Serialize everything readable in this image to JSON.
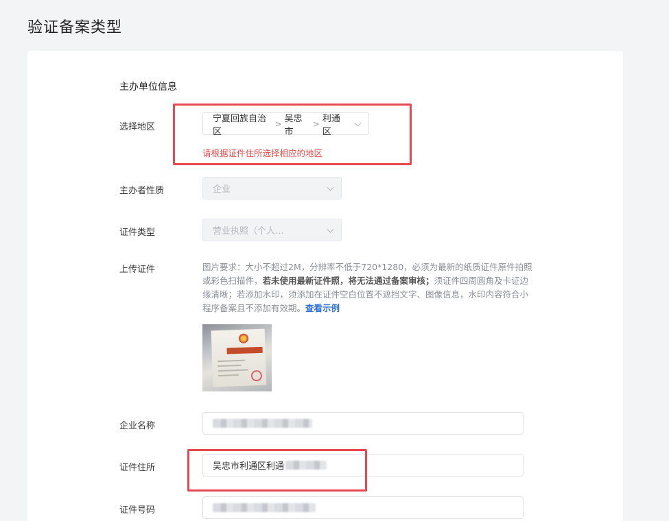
{
  "page_title": "验证备案类型",
  "section_title": "主办单位信息",
  "region": {
    "label": "选择地区",
    "province": "宁夏回族自治区",
    "city": "吴忠市",
    "district": "利通区",
    "separator": ">",
    "hint": "请根据证件住所选择相应的地区"
  },
  "sponsor_type": {
    "label": "主办者性质",
    "value": "企业"
  },
  "cert_type": {
    "label": "证件类型",
    "value": "营业执照（个人..."
  },
  "upload": {
    "label": "上传证件",
    "desc_1": "图片要求：大小不超过2M，分辨率不低于720*1280，必须为最新的纸质证件原件拍照或彩色扫描件，",
    "desc_bold": "若未使用最新证件照，将无法通过备案审核；",
    "desc_2": "须证件四周圆角及卡证边缘清晰；若添加水印，须添加在证件空白位置不遮挡文字、图像信息，水印内容符合小程序备案且不添加有效期。",
    "example_link": "查看示例"
  },
  "company_name": {
    "label": "企业名称",
    "value": ""
  },
  "cert_address": {
    "label": "证件住所",
    "value": "吴忠市利通区利通"
  },
  "cert_number": {
    "label": "证件号码",
    "value": ""
  },
  "colors": {
    "highlight_box": "#e8474f",
    "error_text": "#e84b4b",
    "link": "#2f6fd6"
  }
}
